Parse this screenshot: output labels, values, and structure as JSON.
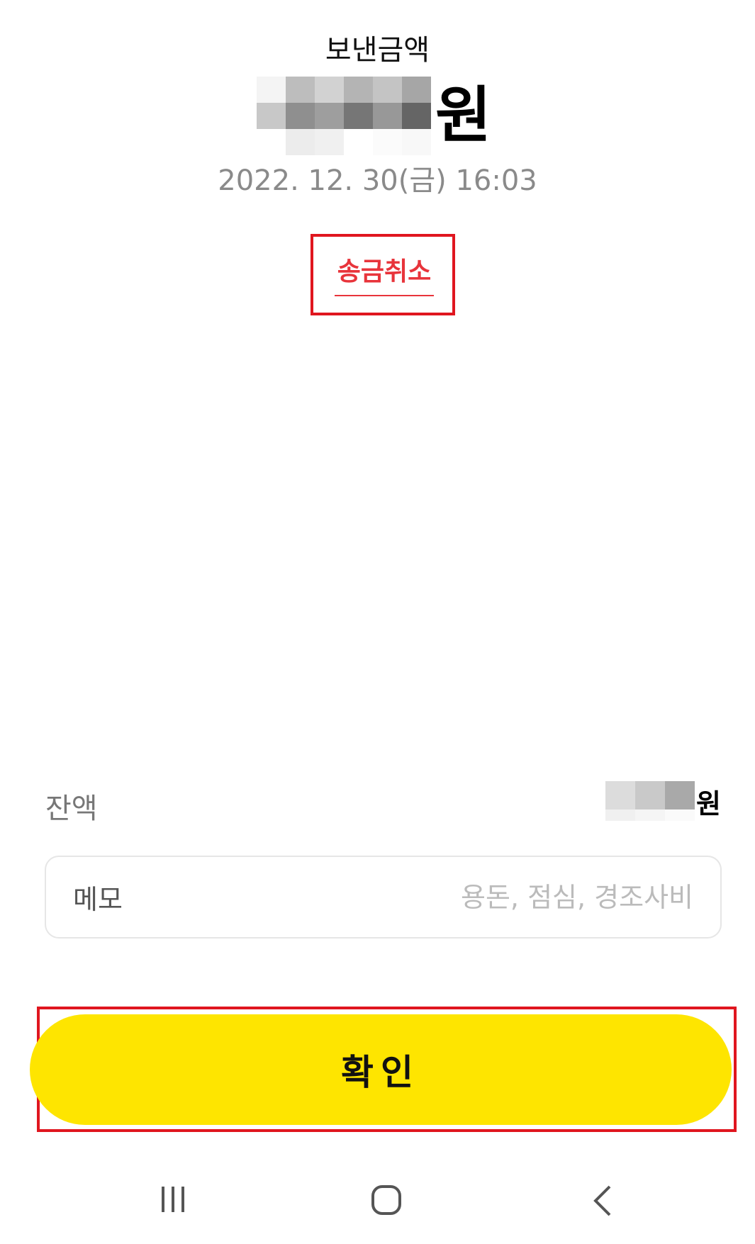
{
  "header": {
    "sent_amount_label": "보낸금액",
    "amount_unit": "원",
    "datetime": "2022. 12. 30(금) 16:03"
  },
  "actions": {
    "cancel_transfer_label": "송금취소",
    "confirm_label": "확인"
  },
  "balance": {
    "label": "잔액",
    "unit": "원"
  },
  "memo": {
    "label": "메모",
    "placeholder": "용돈, 점심, 경조사비",
    "value": ""
  },
  "nav": {
    "recent_icon": "recent-apps-icon",
    "home_icon": "home-icon",
    "back_icon": "back-icon"
  },
  "colors": {
    "accent_yellow": "#fee500",
    "cancel_red": "#e8343b",
    "highlight_box": "#e0161f"
  }
}
